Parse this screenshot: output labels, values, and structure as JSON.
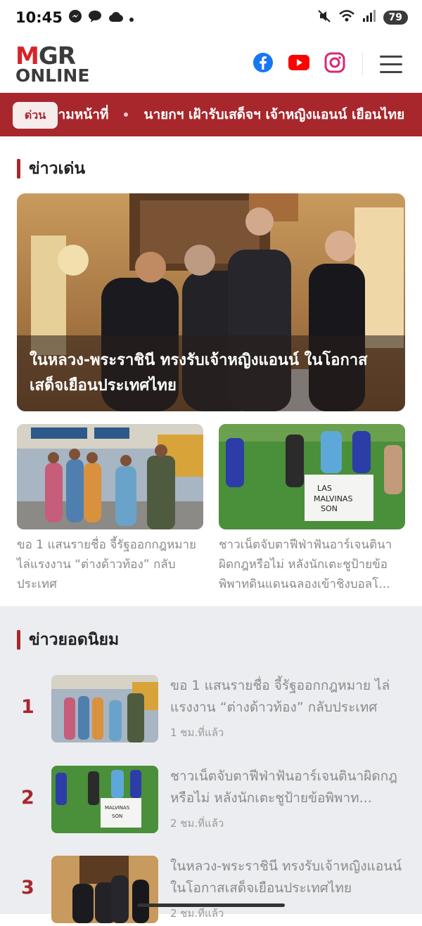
{
  "status_bar": {
    "time": "10:45",
    "battery": "79",
    "icons": [
      "messenger-icon",
      "chat-bubble-icon",
      "cloud-icon",
      "dot-icon",
      "mute-icon",
      "wifi-icon",
      "signal-icon"
    ]
  },
  "header": {
    "logo_top_m": "M",
    "logo_top_gr": "GR",
    "logo_bottom": "ONLINE",
    "social_icons": [
      "facebook-icon",
      "youtube-icon",
      "instagram-icon"
    ],
    "colors": {
      "brand_red": "#d8232a",
      "accent": "#a8272c",
      "facebook": "#1877f2",
      "youtube": "#ff0000",
      "instagram": "#d62976"
    }
  },
  "ticker": {
    "label": "ด่วน",
    "items": [
      "รตามหน้าที่",
      "นายกฯ เฝ้ารับเสด็จฯ เจ้าหญิงแอนน์ เยือนไทย"
    ]
  },
  "featured": {
    "section_title": "ข่าวเด่น",
    "hero_title": "ในหลวง-พระราชินี ทรงรับเจ้าหญิงแอนน์ ในโอกาสเสด็จเยือนประเทศไทย",
    "cards": [
      {
        "title": "ขอ 1 แสนรายชื่อ จี้รัฐออกกฎหมาย ไล่แรงงาน “ต่างด้าวท้อง” กลับประเทศ"
      },
      {
        "title": "ชาวเน็ตจับตาฟีฟ่าฟันอาร์เจนตินาผิดกฎหรือไม่ หลังนักเตะชูป้ายข้อพิพาทดินแดนฉลองเข้าชิงบอลโ..."
      }
    ]
  },
  "popular": {
    "section_title": "ข่าวยอดนิยม",
    "items": [
      {
        "rank": "1",
        "title": "ขอ 1 แสนรายชื่อ จี้รัฐออกกฎหมาย ไล่แรงงาน “ต่างด้าวท้อง” กลับประเทศ",
        "time": "1 ชม.ที่แล้ว"
      },
      {
        "rank": "2",
        "title": "ชาวเน็ตจับตาฟีฟ่าฟันอาร์เจนตินาผิดกฎหรือไม่ หลังนักเตะชูป้ายข้อพิพาท...",
        "time": "2 ชม.ที่แล้ว"
      },
      {
        "rank": "3",
        "title": "ในหลวง-พระราชินี ทรงรับเจ้าหญิงแอนน์ ในโอกาสเสด็จเยือนประเทศไทย",
        "time": "2 ชม.ที่แล้ว"
      }
    ]
  }
}
